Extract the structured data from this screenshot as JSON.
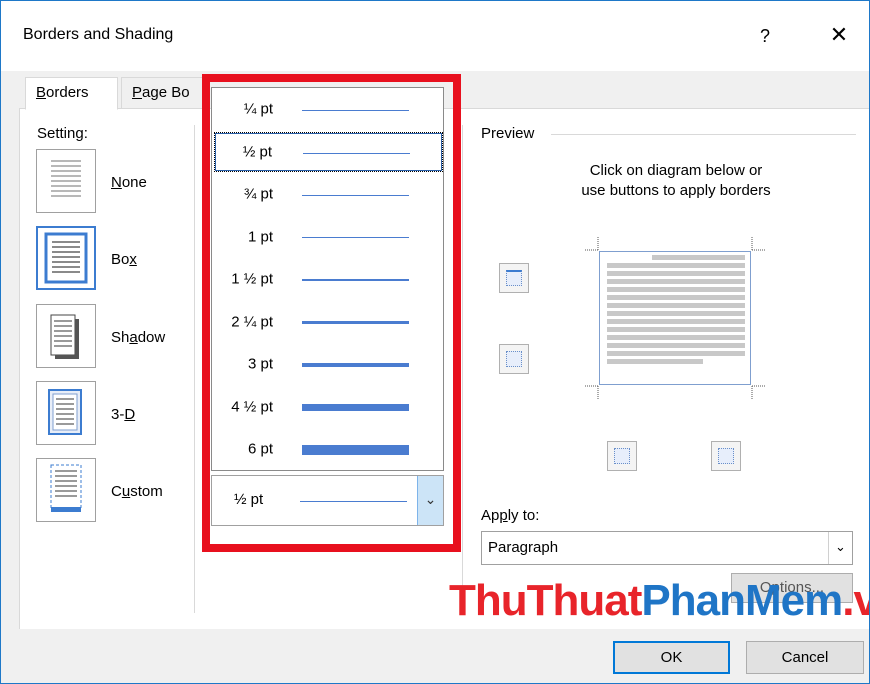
{
  "dialog": {
    "title": "Borders and Shading",
    "help": "?",
    "close": "✕"
  },
  "tabs": {
    "borders": {
      "pre": "",
      "u": "B",
      "post": "orders"
    },
    "page_border": {
      "pre": "",
      "u": "P",
      "post": "age Bo"
    }
  },
  "setting": {
    "label": "Setting:",
    "items": [
      {
        "pre": "",
        "u": "N",
        "post": "one"
      },
      {
        "pre": "Bo",
        "u": "x",
        "post": ""
      },
      {
        "pre": "Sh",
        "u": "a",
        "post": "dow"
      },
      {
        "pre": "3-",
        "u": "D",
        "post": ""
      },
      {
        "pre": "C",
        "u": "u",
        "post": "stom"
      }
    ]
  },
  "width_dropdown": {
    "selected": "½ pt",
    "options": [
      "¼ pt",
      "½ pt",
      "¾ pt",
      "1 pt",
      "1 ½ pt",
      "2 ¼ pt",
      "3 pt",
      "4 ½ pt",
      "6 pt"
    ],
    "option_thickness_px": [
      1,
      1,
      1,
      1,
      2,
      3,
      4,
      7,
      10
    ],
    "line_color": "#4a7cd0",
    "highlighted_option": "½ pt"
  },
  "preview": {
    "title": "Preview",
    "help_line1": "Click on diagram below or",
    "help_line2": "use buttons to apply borders"
  },
  "apply_to": {
    "label_pre": "Ap",
    "label_u": "p",
    "label_post": "ly to:",
    "value": "Paragraph"
  },
  "buttons": {
    "options": "Options...",
    "ok": "OK",
    "cancel": "Cancel"
  },
  "watermark": {
    "part1": "ThuThuat",
    "part2": "PhanMem",
    "part3": ".vn"
  },
  "colors": {
    "highlight_frame": "#e8101e",
    "accent": "#0078d7"
  }
}
